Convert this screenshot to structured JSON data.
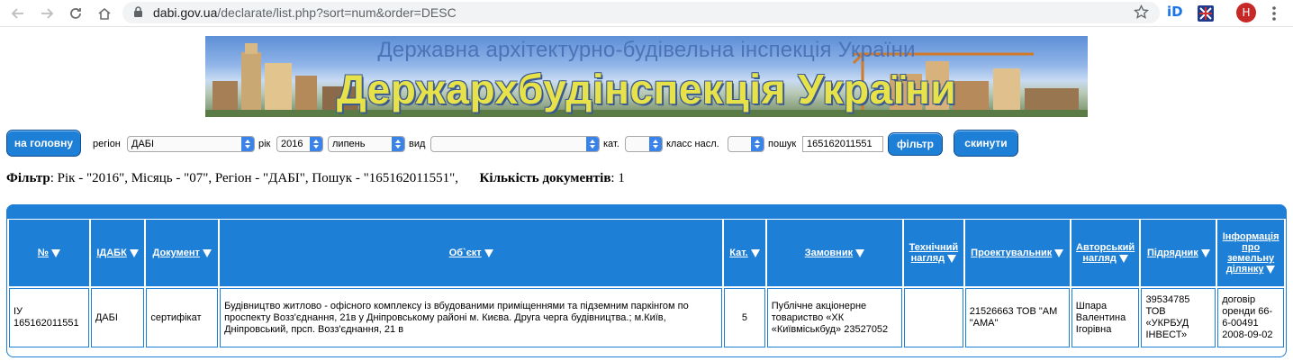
{
  "browser": {
    "url_host": "dabi.gov.ua",
    "url_path": "/declarate/list.php?sort=num&order=DESC",
    "profile_initial": "H",
    "ext_id_label": "iD"
  },
  "banner": {
    "subtitle": "Державна архітектурно-будівельна інспекція України",
    "title": "Держархбудінспекція України"
  },
  "filters": {
    "home_button": "на головну",
    "region_label": "регіон",
    "region_value": "ДАБІ",
    "year_label": "рік",
    "year_value": "2016",
    "month_value": "липень",
    "kind_label": "вид",
    "kind_value": "",
    "cat_label": "кат.",
    "cat_value": "",
    "class_label": "класс насл.",
    "class_value": "",
    "search_label": "пошук",
    "search_value": "165162011551",
    "filter_button": "фільтр",
    "reset_button": "скинути"
  },
  "summary": {
    "filter_label": "Фільтр",
    "filter_text": ": Рік - \"2016\", Місяць - \"07\", Регіон - \"ДАБІ\", Пошук - \"165162011551\",",
    "count_label": "Кількість документів",
    "count_value": ": 1"
  },
  "table": {
    "headers": {
      "num": "№",
      "idabk": "ІДАБК",
      "doc": "Документ",
      "object": "Об`єкт",
      "cat": "Кат.",
      "customer": "Замовник",
      "tech_1": "Технічний",
      "tech_2": "нагляд",
      "designer": "Проектувальник",
      "author_1": "Авторський",
      "author_2": "нагляд",
      "contractor": "Підрядник",
      "land_1": "Інформація",
      "land_2": "про",
      "land_3": "земельну",
      "land_4": "ділянку"
    },
    "row": {
      "num": "ІУ 165162011551",
      "idabk": "ДАБІ",
      "doc": "сертифікат",
      "object": "Будівництво житлово - офісного комплексу із вбудованими приміщеннями та підземним паркінгом по проспекту Возз'єднання, 21в у Дніпровському районі м. Києва. Друга черга будівництва.; м.Київ, Дніпровський, прсп. Возз'єднання, 21 в",
      "cat": "5",
      "customer": "Публічне акціонерне товариство «ХК «Київміськбуд» 23527052",
      "tech": "",
      "designer": "21526663 ТОВ \"АМ \"АМА\"",
      "author": "Шпара Валентина Ігорівна",
      "contractor": "39534785 ТОВ «УКРБУД ІНВЕСТ»",
      "land": "договір оренди 66-6-00491 2008-09-02"
    }
  }
}
